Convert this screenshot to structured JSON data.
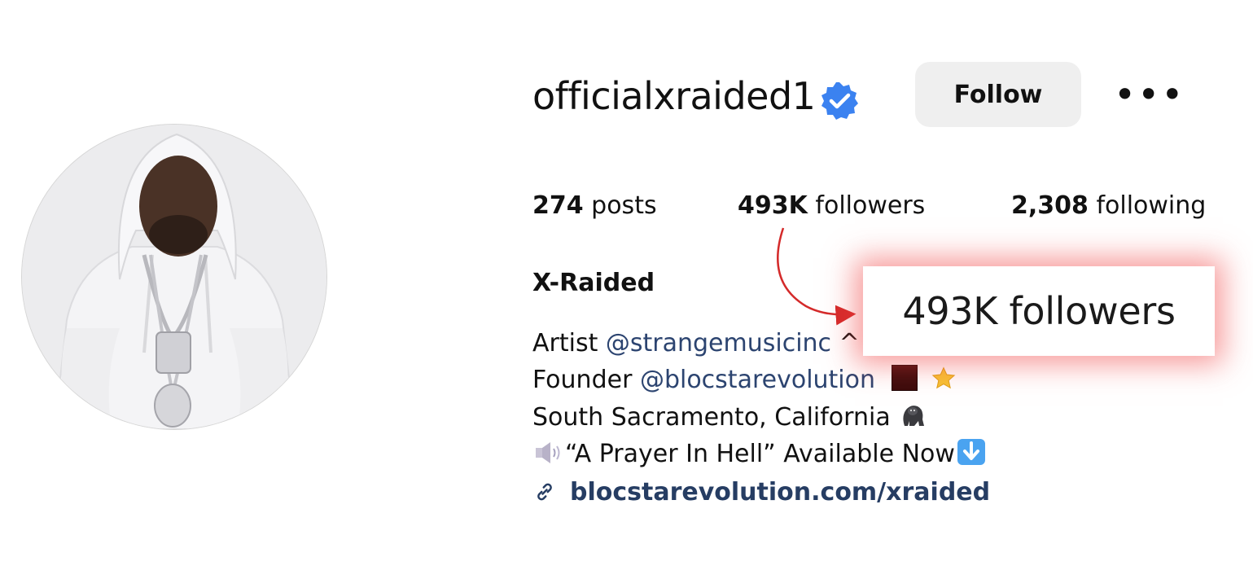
{
  "profile": {
    "username": "officialxraided1",
    "verified_badge_icon": "verified-check-icon",
    "follow_label": "Follow",
    "more_icon": "more-dots-icon",
    "more_label": "•••"
  },
  "stats": {
    "posts_count": "274",
    "posts_label": " posts",
    "followers_count": "493K",
    "followers_label": " followers",
    "following_count": "2,308",
    "following_label": " following"
  },
  "bio": {
    "full_name": "X-Raided",
    "line1_prefix": "Artist ",
    "line1_mention": "@strangemusicinc",
    "line1_suffix": " ^",
    "line2_prefix": "Founder ",
    "line2_mention": "@blocstarevolution",
    "line3_text": "South Sacramento, California ",
    "line4_text": "“A Prayer In Hell” Available Now",
    "link_icon": "link-icon",
    "link_text": "blocstarevolution.com/xraided"
  },
  "callout": {
    "text": "493K followers",
    "glow_color": "#f04646",
    "arrow_color": "#d42a2a"
  },
  "colors": {
    "verified_blue": "#3b82f0",
    "mention_blue": "#2c4470",
    "link_blue": "#263d63",
    "button_gray": "#efefef"
  }
}
